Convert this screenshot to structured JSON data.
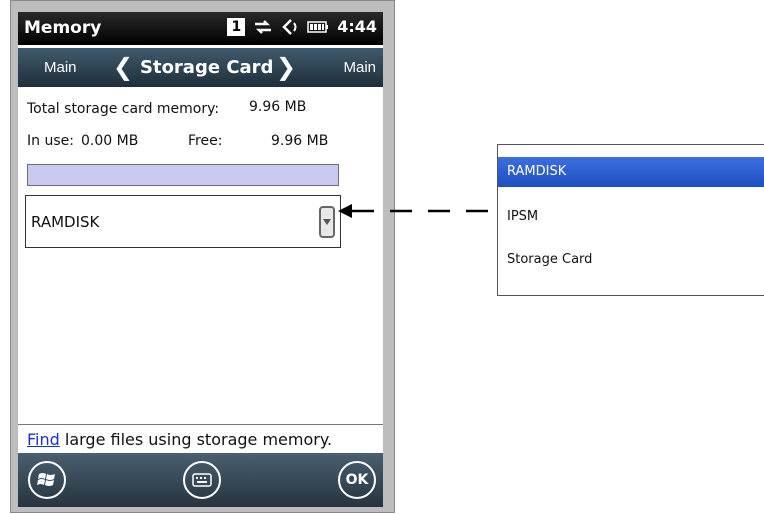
{
  "title_bar": {
    "app_title": "Memory",
    "sim_indicator": "1",
    "time": "4:44",
    "icons": [
      "connectivity-icon",
      "volume-icon",
      "battery-icon"
    ]
  },
  "nav": {
    "left_label": "Main",
    "center_label": "Storage Card",
    "right_label": "Main",
    "prev_glyph": "❮",
    "next_glyph": "❯"
  },
  "memory": {
    "total_label": "Total storage card memory:",
    "total_value": "9.96 MB",
    "in_use_label": "In use:",
    "in_use_value": "0.00 MB",
    "free_label": "Free:",
    "free_value": "9.96 MB",
    "usage_fraction": 0.0
  },
  "dropdown": {
    "selected": "RAMDISK"
  },
  "footer_hint": {
    "link_text": "Find",
    "rest_text": " large files using storage memory."
  },
  "softkeys": {
    "start_icon": "windows-start-icon",
    "keyboard_icon": "keyboard-icon",
    "ok_label": "OK"
  },
  "popup_list": {
    "options": [
      "RAMDISK",
      "IPSM",
      "Storage Card"
    ],
    "selected_index": 0
  },
  "colors": {
    "selection": "#2a5bd7",
    "link": "#1a2fd6",
    "usage_bar": "#c9c9ef"
  }
}
